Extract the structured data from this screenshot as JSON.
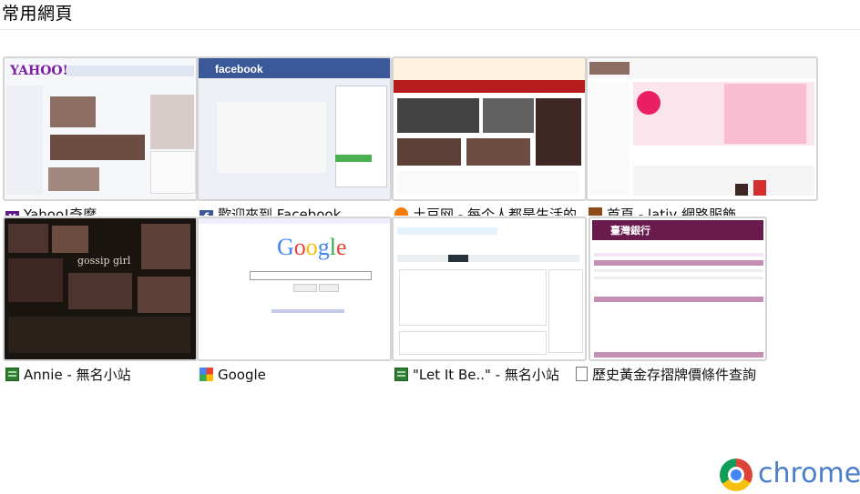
{
  "page": {
    "heading": "常用網頁"
  },
  "tiles": [
    {
      "title": "Yahoo!奇摩",
      "favicon": "yahoo-icon"
    },
    {
      "title": "歡迎來到 Facebook",
      "favicon": "facebook-icon"
    },
    {
      "title": "土豆网 - 每个人都是生活的",
      "favicon": "tudou-icon"
    },
    {
      "title": "首頁 - latiy 網路服飾",
      "favicon": "latiy-icon"
    },
    {
      "title": "Annie - 無名小站",
      "favicon": "wretch-icon"
    },
    {
      "title": "Google",
      "favicon": "google-icon"
    },
    {
      "title": "\"Let It Be..\" - 無名小站",
      "favicon": "wretch-icon"
    },
    {
      "title": "歷史黃金存摺牌價條件查詢",
      "favicon": "document-icon"
    }
  ],
  "thumbnail_text": {
    "yahoo_logo": "YAHOO!",
    "facebook_logo": "facebook",
    "google_logo": "Google",
    "gossip_text": "gossip girl",
    "bank_title": "臺灣銀行"
  },
  "brand": {
    "text": "chrome"
  }
}
